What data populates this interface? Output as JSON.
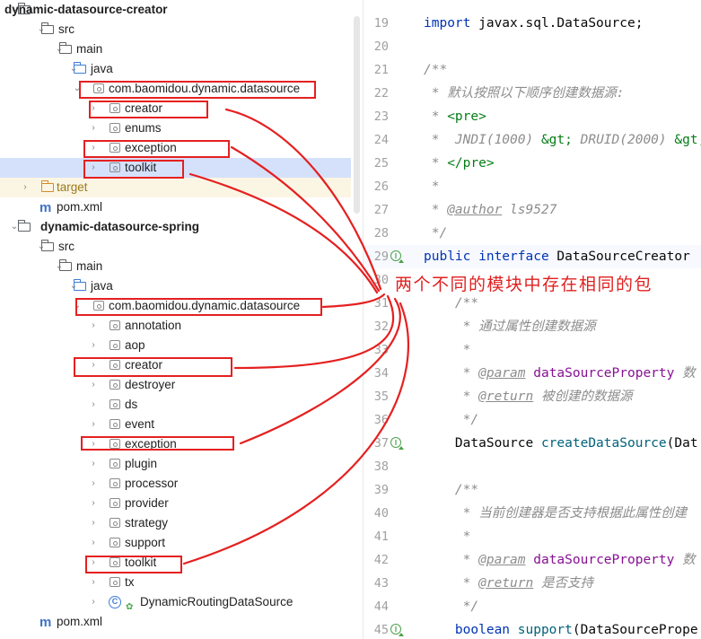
{
  "project_tree": {
    "rows": [
      {
        "label": "dynamic-datasource-creator",
        "chev": "⌄",
        "kind": "module"
      },
      {
        "label": "src",
        "chev": "⌄",
        "kind": "folder"
      },
      {
        "label": "main",
        "chev": "⌄",
        "kind": "folder"
      },
      {
        "label": "java",
        "chev": "⌄",
        "kind": "folder-blue"
      },
      {
        "label": "com.baomidou.dynamic.datasource",
        "chev": "⌄",
        "kind": "package"
      },
      {
        "label": "creator",
        "chev": "›",
        "kind": "package"
      },
      {
        "label": "enums",
        "chev": "›",
        "kind": "package"
      },
      {
        "label": "exception",
        "chev": "›",
        "kind": "package"
      },
      {
        "label": "toolkit",
        "chev": "›",
        "kind": "package",
        "selected": true
      },
      {
        "label": "target",
        "chev": "›",
        "kind": "folder-orange"
      },
      {
        "label": "pom.xml",
        "chev": "",
        "kind": "maven"
      },
      {
        "label": "dynamic-datasource-spring",
        "chev": "⌄",
        "kind": "module"
      },
      {
        "label": "src",
        "chev": "⌄",
        "kind": "folder"
      },
      {
        "label": "main",
        "chev": "⌄",
        "kind": "folder"
      },
      {
        "label": "java",
        "chev": "⌄",
        "kind": "folder-blue"
      },
      {
        "label": "com.baomidou.dynamic.datasource",
        "chev": "⌄",
        "kind": "package"
      },
      {
        "label": "annotation",
        "chev": "›",
        "kind": "package"
      },
      {
        "label": "aop",
        "chev": "›",
        "kind": "package"
      },
      {
        "label": "creator",
        "chev": "›",
        "kind": "package"
      },
      {
        "label": "destroyer",
        "chev": "›",
        "kind": "package"
      },
      {
        "label": "ds",
        "chev": "›",
        "kind": "package"
      },
      {
        "label": "event",
        "chev": "›",
        "kind": "package"
      },
      {
        "label": "exception",
        "chev": "›",
        "kind": "package"
      },
      {
        "label": "plugin",
        "chev": "›",
        "kind": "package"
      },
      {
        "label": "processor",
        "chev": "›",
        "kind": "package"
      },
      {
        "label": "provider",
        "chev": "›",
        "kind": "package"
      },
      {
        "label": "strategy",
        "chev": "›",
        "kind": "package"
      },
      {
        "label": "support",
        "chev": "›",
        "kind": "package"
      },
      {
        "label": "toolkit",
        "chev": "›",
        "kind": "package"
      },
      {
        "label": "tx",
        "chev": "›",
        "kind": "package"
      },
      {
        "label": "DynamicRoutingDataSource",
        "chev": "›",
        "kind": "class"
      },
      {
        "label": "pom.xml",
        "chev": "",
        "kind": "maven"
      }
    ]
  },
  "editor": {
    "lines": [
      {
        "num": "19",
        "tokens": [
          {
            "t": "import ",
            "c": "kw"
          },
          {
            "t": "javax.sql.DataSource;",
            "c": "plain"
          }
        ]
      },
      {
        "num": "20",
        "tokens": []
      },
      {
        "num": "21",
        "tokens": [
          {
            "t": "/**",
            "c": "cm"
          }
        ]
      },
      {
        "num": "22",
        "tokens": [
          {
            "t": " * 默认按照以下顺序创建数据源:",
            "c": "cm"
          }
        ]
      },
      {
        "num": "23",
        "tokens": [
          {
            "t": " * ",
            "c": "cm"
          },
          {
            "t": "<pre>",
            "c": "tag"
          }
        ]
      },
      {
        "num": "24",
        "tokens": [
          {
            "t": " *  JNDI(1000) ",
            "c": "cm"
          },
          {
            "t": "&gt;",
            "c": "tag"
          },
          {
            "t": " DRUID(2000) ",
            "c": "cm"
          },
          {
            "t": "&gt;",
            "c": "tag"
          }
        ]
      },
      {
        "num": "25",
        "tokens": [
          {
            "t": " * ",
            "c": "cm"
          },
          {
            "t": "</pre>",
            "c": "tag"
          }
        ]
      },
      {
        "num": "26",
        "tokens": [
          {
            "t": " *",
            "c": "cm"
          }
        ]
      },
      {
        "num": "27",
        "tokens": [
          {
            "t": " * ",
            "c": "cm"
          },
          {
            "t": "@author",
            "c": "doctag"
          },
          {
            "t": " ls9527",
            "c": "cm"
          }
        ]
      },
      {
        "num": "28",
        "tokens": [
          {
            "t": " */",
            "c": "cm"
          }
        ]
      },
      {
        "num": "29",
        "gutter": true,
        "tokens": [
          {
            "t": "public interface ",
            "c": "kw"
          },
          {
            "t": "DataSourceCreator",
            "c": "plain"
          }
        ]
      },
      {
        "num": "30",
        "tokens": []
      },
      {
        "num": "31",
        "tokens": [
          {
            "t": "    /**",
            "c": "cm"
          }
        ]
      },
      {
        "num": "32",
        "tokens": [
          {
            "t": "     * 通过属性创建数据源",
            "c": "cm"
          }
        ]
      },
      {
        "num": "33",
        "tokens": [
          {
            "t": "     *",
            "c": "cm"
          }
        ]
      },
      {
        "num": "34",
        "tokens": [
          {
            "t": "     * ",
            "c": "cm"
          },
          {
            "t": "@param",
            "c": "doctag"
          },
          {
            "t": " dataSourceProperty",
            "c": "pv"
          },
          {
            "t": " 数",
            "c": "cm"
          }
        ]
      },
      {
        "num": "35",
        "tokens": [
          {
            "t": "     * ",
            "c": "cm"
          },
          {
            "t": "@return",
            "c": "doctag"
          },
          {
            "t": " 被创建的数据源",
            "c": "cm"
          }
        ]
      },
      {
        "num": "36",
        "tokens": [
          {
            "t": "     */",
            "c": "cm"
          }
        ]
      },
      {
        "num": "37",
        "gutter": true,
        "tokens": [
          {
            "t": "    DataSource ",
            "c": "plain"
          },
          {
            "t": "createDataSource",
            "c": "method"
          },
          {
            "t": "(Dat",
            "c": "plain"
          }
        ]
      },
      {
        "num": "38",
        "tokens": []
      },
      {
        "num": "39",
        "tokens": [
          {
            "t": "    /**",
            "c": "cm"
          }
        ]
      },
      {
        "num": "40",
        "tokens": [
          {
            "t": "     * 当前创建器是否支持根据此属性创建",
            "c": "cm"
          }
        ]
      },
      {
        "num": "41",
        "tokens": [
          {
            "t": "     *",
            "c": "cm"
          }
        ]
      },
      {
        "num": "42",
        "tokens": [
          {
            "t": "     * ",
            "c": "cm"
          },
          {
            "t": "@param",
            "c": "doctag"
          },
          {
            "t": " dataSourceProperty",
            "c": "pv"
          },
          {
            "t": " 数",
            "c": "cm"
          }
        ]
      },
      {
        "num": "43",
        "tokens": [
          {
            "t": "     * ",
            "c": "cm"
          },
          {
            "t": "@return",
            "c": "doctag"
          },
          {
            "t": " 是否支持",
            "c": "cm"
          }
        ]
      },
      {
        "num": "44",
        "tokens": [
          {
            "t": "     */",
            "c": "cm"
          }
        ]
      },
      {
        "num": "45",
        "gutter": true,
        "tokens": [
          {
            "t": "    boolean ",
            "c": "kw"
          },
          {
            "t": "support",
            "c": "method"
          },
          {
            "t": "(DataSourcePrope",
            "c": "plain"
          }
        ]
      }
    ]
  },
  "annotation": {
    "text": "两个不同的模块中存在相同的包",
    "color": "#e0201f"
  },
  "colors": {
    "selection": "#d5e1fb",
    "annotation_red": "#e52020"
  }
}
